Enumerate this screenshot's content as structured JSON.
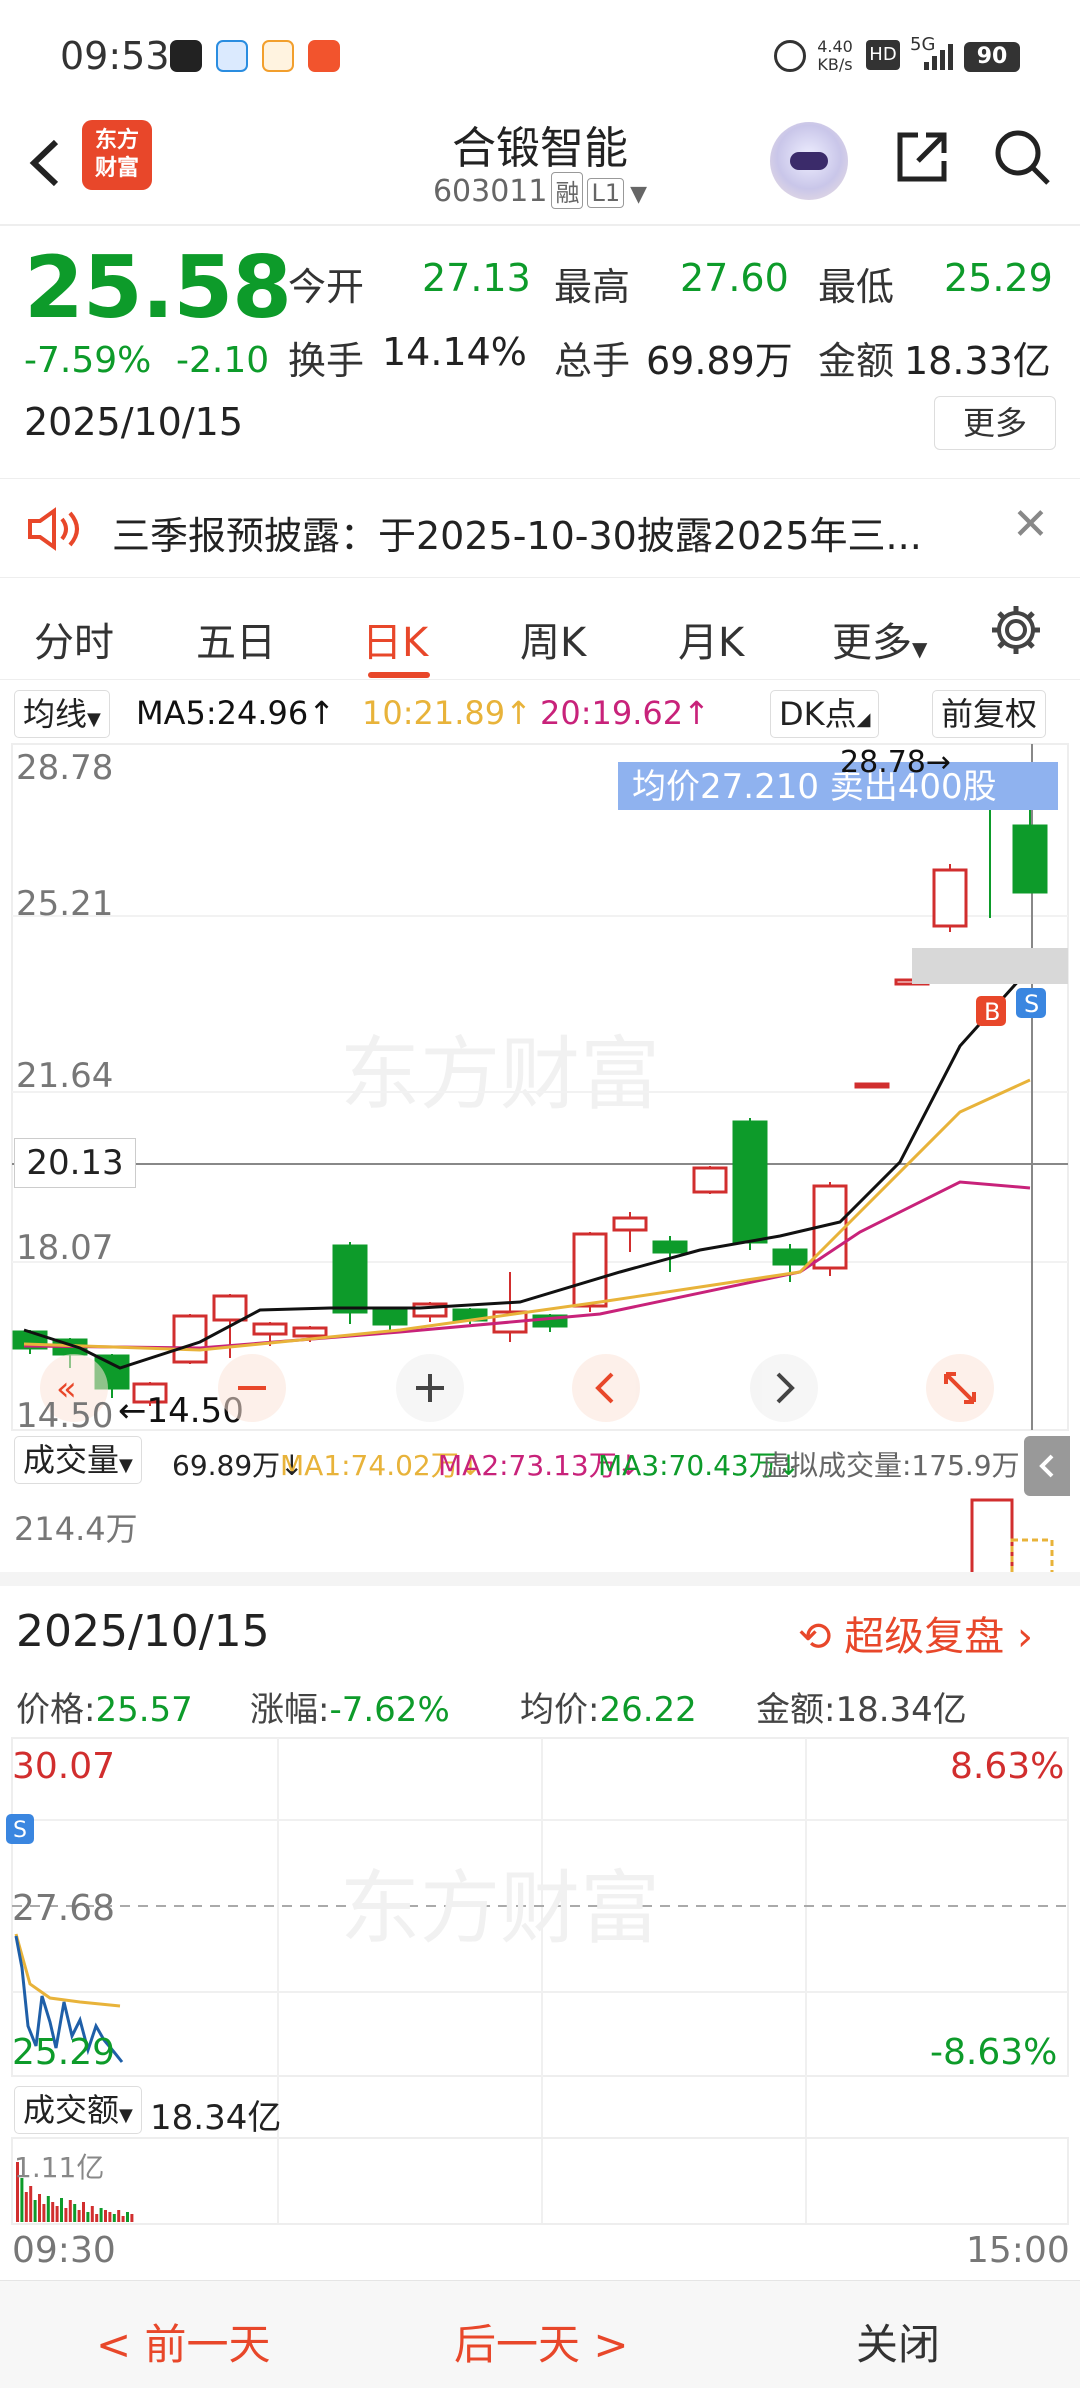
{
  "status": {
    "time": "09:53",
    "speed": "4.40\nKB/s",
    "speed_line1": "4.40",
    "speed_line2": "KB/s",
    "hd": "HD",
    "net": "5G",
    "battery": "90"
  },
  "header": {
    "logo_line1": "东方",
    "logo_line2": "财富",
    "title": "合锻智能",
    "code": "603011",
    "tag_margin": "融",
    "tag_level": "L1"
  },
  "quote": {
    "price": "25.58",
    "change_pct": "-7.59%",
    "change": "-2.10",
    "date": "2025/10/15",
    "open_label": "今开",
    "open": "27.13",
    "high_label": "最高",
    "high": "27.60",
    "low_label": "最低",
    "low": "25.29",
    "turnover_label": "换手",
    "turnover": "14.14%",
    "volume_label": "总手",
    "volume": "69.89万",
    "amount_label": "金额",
    "amount": "18.33亿",
    "more": "更多"
  },
  "notice": {
    "text": "三季报预披露：于2025-10-30披露2025年三..."
  },
  "tabs": [
    "分时",
    "五日",
    "日K",
    "周K",
    "月K",
    "更多"
  ],
  "ma": {
    "label": "均线",
    "ma5": "MA5:24.96↑",
    "ma10": "10:21.89↑",
    "ma20": "20:19.62↑",
    "dk": "DK点",
    "adj": "前复权"
  },
  "kline": {
    "y_labels": [
      "28.78",
      "25.21",
      "21.64",
      "18.07",
      "14.50"
    ],
    "cross_price": "20.13",
    "max_note": "28.78→",
    "min_note": "←14.50",
    "trade_note": "均价27.210  卖出400股",
    "watermark": "东方财富",
    "marker_b": "B",
    "marker_s": "S"
  },
  "vol": {
    "label": "成交量",
    "v": "69.89万↓",
    "ma1": "MA1:74.02万↓",
    "ma2": "MA2:73.13万↓",
    "ma3": "MA3:70.43万↓",
    "virtual": "虚拟成交量:175.9万",
    "ymax": "214.4万"
  },
  "intraday": {
    "date": "2025/10/15",
    "replay": "超级复盘",
    "price_label": "价格:",
    "price": "25.57",
    "pct_label": "涨幅:",
    "pct": "-7.62%",
    "avg_label": "均价:",
    "avg": "26.22",
    "amt_label": "金额:",
    "amt": "18.34亿",
    "y_top": "30.07",
    "y_mid": "27.68",
    "y_bot": "25.29",
    "pct_top": "8.63%",
    "pct_bot": "-8.63%",
    "amount_label": "成交额",
    "amount": "18.34亿",
    "amount_ymax": "1.11亿",
    "t_start": "09:30",
    "t_end": "15:00",
    "marker_s": "S"
  },
  "bottom": {
    "prev": "< 前一天",
    "next": "后一天 >",
    "close": "关闭"
  },
  "colors": {
    "up": "#d12e2e",
    "down": "#0d9b2a",
    "accent": "#e8472a",
    "ma5": "#111111",
    "ma10": "#e8b33a",
    "ma20": "#c8227a"
  }
}
